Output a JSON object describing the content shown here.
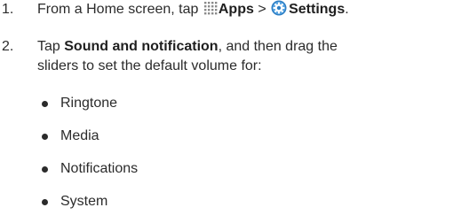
{
  "steps": [
    {
      "number": "1.",
      "text_before": "From a Home screen, tap",
      "apps_label": "Apps",
      "separator": ">",
      "settings_label": "Settings",
      "text_after": "."
    },
    {
      "number": "2.",
      "text_before": "Tap",
      "bold_label": "Sound and notification",
      "line1_after": ", and then drag the",
      "line2": "sliders to set the default volume for:"
    }
  ],
  "bullets": [
    "Ringtone",
    "Media",
    "Notifications",
    "System"
  ],
  "icons": {
    "apps": "apps-grid-icon",
    "settings": "settings-gear-icon"
  },
  "colors": {
    "text": "#2b2b2b",
    "apps_icon": "#8a8a8a",
    "settings_icon": "#2f7fc4"
  }
}
